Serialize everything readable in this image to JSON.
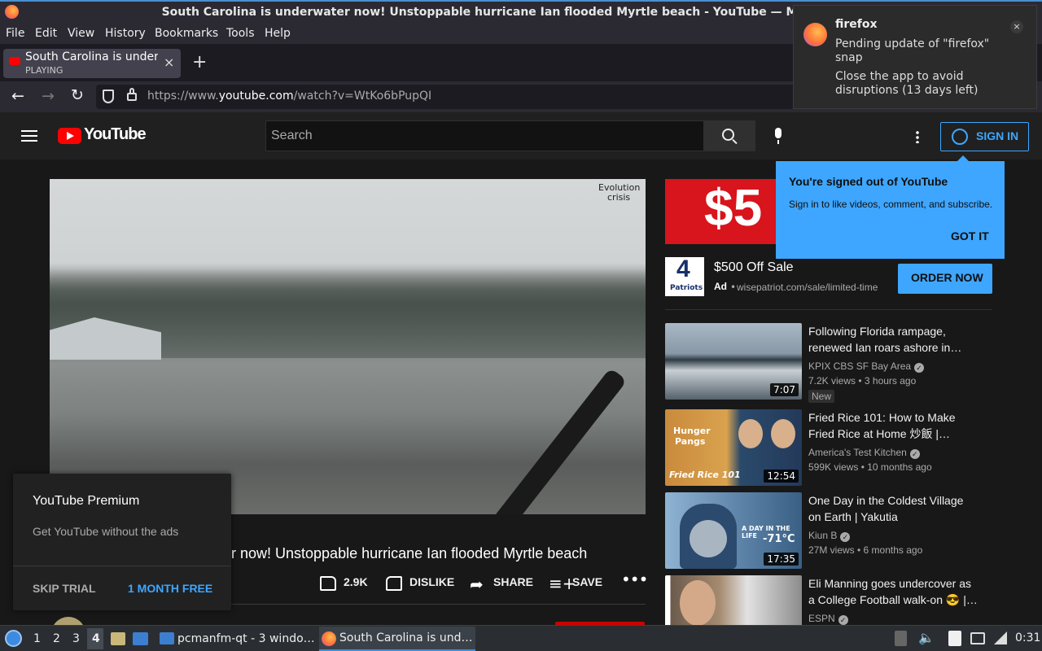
{
  "window": {
    "title": "South Carolina is underwater now! Unstoppable hurricane Ian flooded Myrtle beach - YouTube — Mozilla Firefox"
  },
  "menu": [
    "File",
    "Edit",
    "View",
    "History",
    "Bookmarks",
    "Tools",
    "Help"
  ],
  "tab": {
    "title": "South Carolina is underw",
    "status": "PLAYING"
  },
  "url": {
    "prefix": "https://www.",
    "domain": "youtube.com",
    "path": "/watch?v=WtKo6bPupQI"
  },
  "youtube": {
    "logo": "YouTube",
    "search_placeholder": "Search",
    "sign_in": "SIGN IN",
    "video": {
      "watermark_line1": "Evolution",
      "watermark_line2": "crisis",
      "title_visible": "r now! Unstoppable hurricane Ian flooded Myrtle beach",
      "likes": "2.9K",
      "dislike": "DISLIKE",
      "share": "SHARE",
      "save": "SAVE"
    },
    "ad": {
      "banner_text": "$5",
      "title": "$500 Off Sale",
      "badge": "Ad",
      "domain": "wisepatriot.com/sale/limited-time",
      "cta": "ORDER NOW",
      "logo_number": "4",
      "logo_text": "Patriots"
    },
    "recommendations": [
      {
        "title_l1": "Following Florida rampage,",
        "title_l2": "renewed Ian roars ashore in…",
        "channel": "KPIX CBS SF Bay Area",
        "verified": true,
        "meta": "7.2K views • 3 hours ago",
        "badge": "New",
        "duration": "7:07",
        "thumb_colors": [
          "#8ea3b4",
          "#3f4c58"
        ]
      },
      {
        "title_l1": "Fried Rice 101: How to Make",
        "title_l2": "Fried Rice at Home 炒飯 |…",
        "channel": "America's Test Kitchen",
        "verified": true,
        "meta": "599K views • 10 months ago",
        "badge": "",
        "duration": "12:54",
        "thumb_colors": [
          "#c98a3c",
          "#2a4a6b"
        ],
        "thumb_text_1": "Hunger",
        "thumb_text_2": "Pangs",
        "thumb_text_3": "Fried Rice 101"
      },
      {
        "title_l1": "One Day in the Coldest Village",
        "title_l2": "on Earth | Yakutia",
        "channel": "Kiun B",
        "verified": true,
        "meta": "27M views • 6 months ago",
        "badge": "",
        "duration": "17:35",
        "thumb_colors": [
          "#7fa6c9",
          "#2d4e72"
        ],
        "thumb_text_1": "A DAY IN THE LIFE",
        "thumb_text_2": "-71°C"
      },
      {
        "title_l1": "Eli Manning goes undercover as",
        "title_l2": "a College Football walk-on 😎 |…",
        "channel": "ESPN",
        "verified": true,
        "meta": "",
        "badge": "",
        "duration": "",
        "thumb_colors": [
          "#b8a28c",
          "#3b3330"
        ]
      }
    ],
    "tooltip": {
      "title": "You're signed out of YouTube",
      "body": "Sign in to like videos, comment, and subscribe.",
      "button": "GOT IT"
    },
    "premium": {
      "title": "YouTube Premium",
      "body": "Get YouTube without the ads",
      "skip": "SKIP TRIAL",
      "trial": "1 MONTH FREE"
    }
  },
  "notification": {
    "app": "firefox",
    "line1": "Pending update of \"firefox\"",
    "line2": "snap",
    "line3": "Close the app to avoid",
    "line4": "disruptions (13 days left)"
  },
  "taskbar": {
    "workspaces": [
      "1",
      "2",
      "3",
      "4"
    ],
    "active_workspace": "4",
    "task1": "pcmanfm-qt - 3 windo…",
    "task2": "South Carolina is und…",
    "clock": "0:31"
  },
  "colors": {
    "accent": "#3ea6ff",
    "yt_red": "#ff0000",
    "bg": "#181818"
  }
}
